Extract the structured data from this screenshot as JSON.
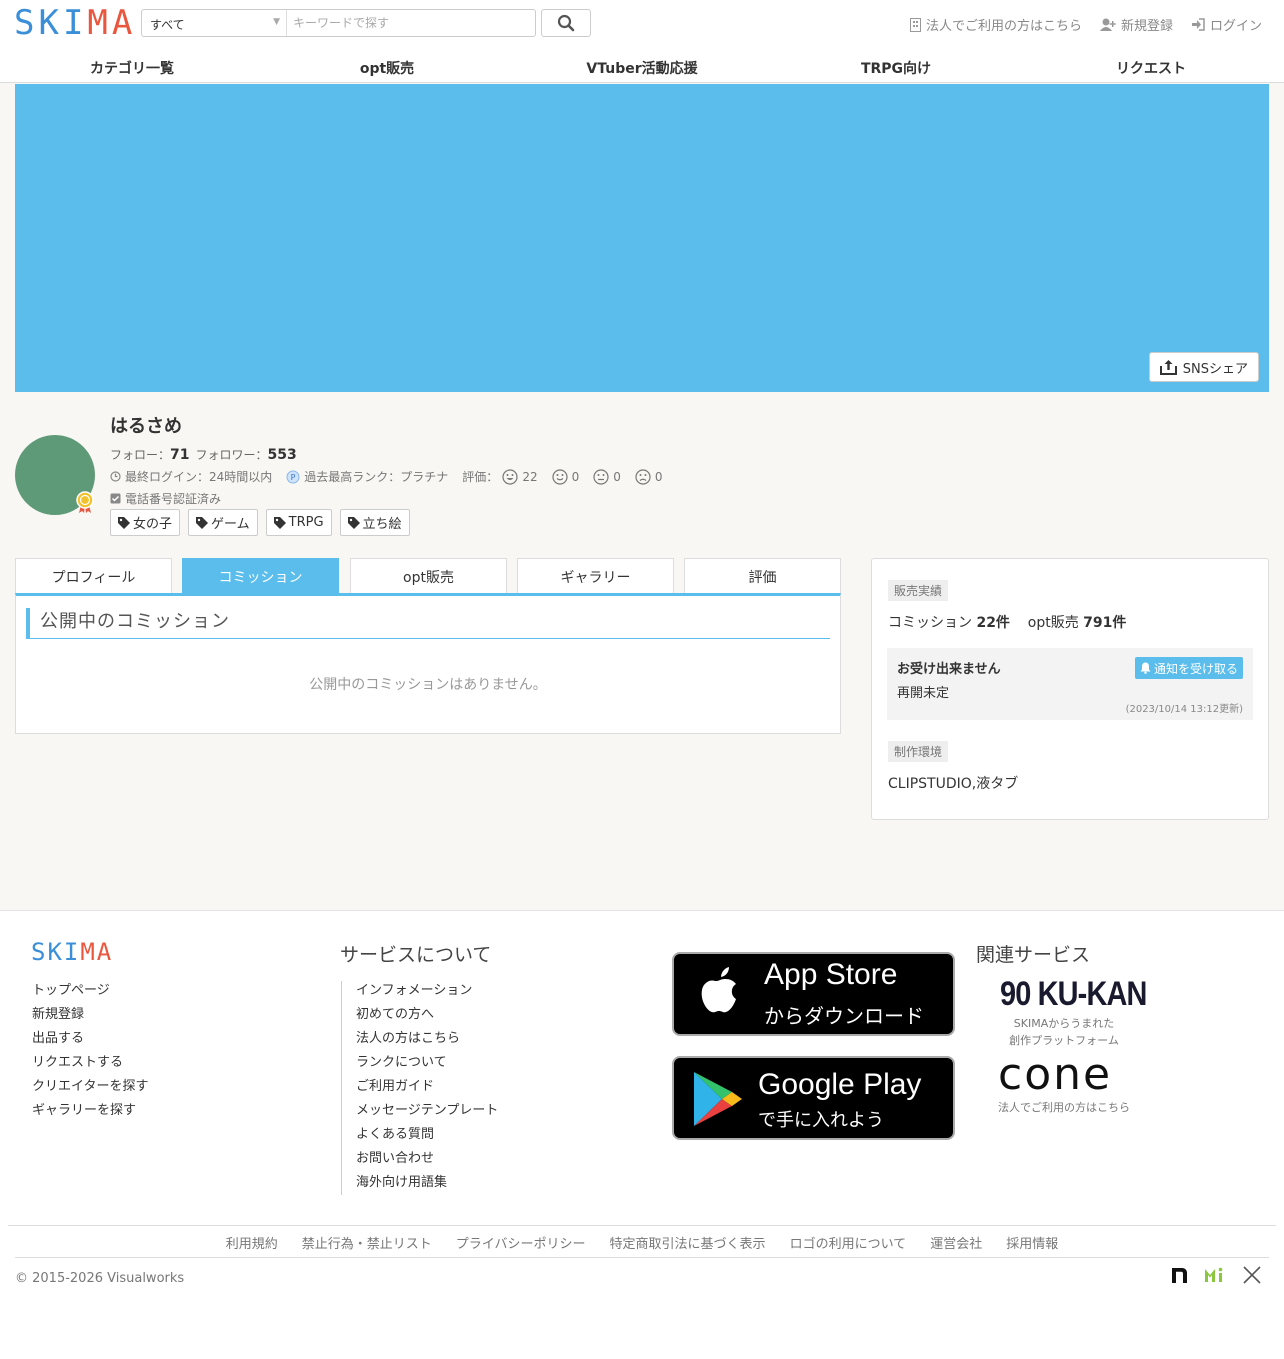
{
  "header": {
    "logo": {
      "part1": "SKI",
      "part2": "MA"
    },
    "search": {
      "category": "すべて",
      "placeholder": "キーワードで探す"
    },
    "links": {
      "corporate": "法人でご利用の方はこちら",
      "register": "新規登録",
      "login": "ログイン"
    }
  },
  "nav": {
    "items": [
      "カテゴリ一覧",
      "opt販売",
      "VTuber活動応援",
      "TRPG向け",
      "リクエスト"
    ]
  },
  "banner": {
    "share_label": "SNSシェア",
    "color": "#5bbdec"
  },
  "profile": {
    "name": "はるさめ",
    "follow_label": "フォロー：",
    "follow_count": "71",
    "follower_label": "フォロワー：",
    "follower_count": "553",
    "last_login": "最終ログイン：24時間以内",
    "rank": "過去最高ランク：プラチナ",
    "rating_label": "評価：",
    "ratings": [
      "22",
      "0",
      "0",
      "0"
    ],
    "phone_verified": "電話番号認証済み",
    "tags": [
      "女の子",
      "ゲーム",
      "TRPG",
      "立ち絵"
    ]
  },
  "tabs": {
    "items": [
      "プロフィール",
      "コミッション",
      "opt販売",
      "ギャラリー",
      "評価"
    ],
    "active": "コミッション"
  },
  "panel": {
    "title": "公開中のコミッション",
    "empty": "公開中のコミッションはありません。"
  },
  "sidebar": {
    "sales_label": "販売実績",
    "commission_label": "コミッション",
    "commission_count": "22件",
    "opt_label": "opt販売",
    "opt_count": "791件",
    "notice_title": "お受け出来ません",
    "notice_body": "再開未定",
    "notice_updated": "(2023/10/14 13:12更新)",
    "notify_button": "通知を受け取る",
    "env_label": "制作環境",
    "env_value": "CLIPSTUDIO,液タブ"
  },
  "footer": {
    "logo": {
      "part1": "SKI",
      "part2": "MA"
    },
    "col1": [
      "トップページ",
      "新規登録",
      "出品する",
      "リクエストする",
      "クリエイターを探す",
      "ギャラリーを探す"
    ],
    "service_heading": "サービスについて",
    "col2": [
      "インフォメーション",
      "初めての方へ",
      "法人の方はこちら",
      "ランクについて",
      "ご利用ガイド",
      "メッセージテンプレート",
      "よくある質問",
      "お問い合わせ",
      "海外向け用語集"
    ],
    "appstore": {
      "big": "App Store",
      "small": "からダウンロード"
    },
    "googleplay": {
      "big": "Google Play",
      "small": "で手に入れよう"
    },
    "related_heading": "関連サービス",
    "kukan": "90 KU-KAN",
    "kukan_sub1": "SKIMAからうまれた",
    "kukan_sub2": "創作プラットフォーム",
    "cone": "cone",
    "cone_sub": "法人でご利用の方はこちら",
    "bottom_links": [
      "利用規約",
      "禁止行為・禁止リスト",
      "プライバシーポリシー",
      "特定商取引法に基づく表示",
      "ロゴの利用について",
      "運営会社",
      "採用情報"
    ],
    "copyright": "© 2015-2026 Visualworks"
  }
}
